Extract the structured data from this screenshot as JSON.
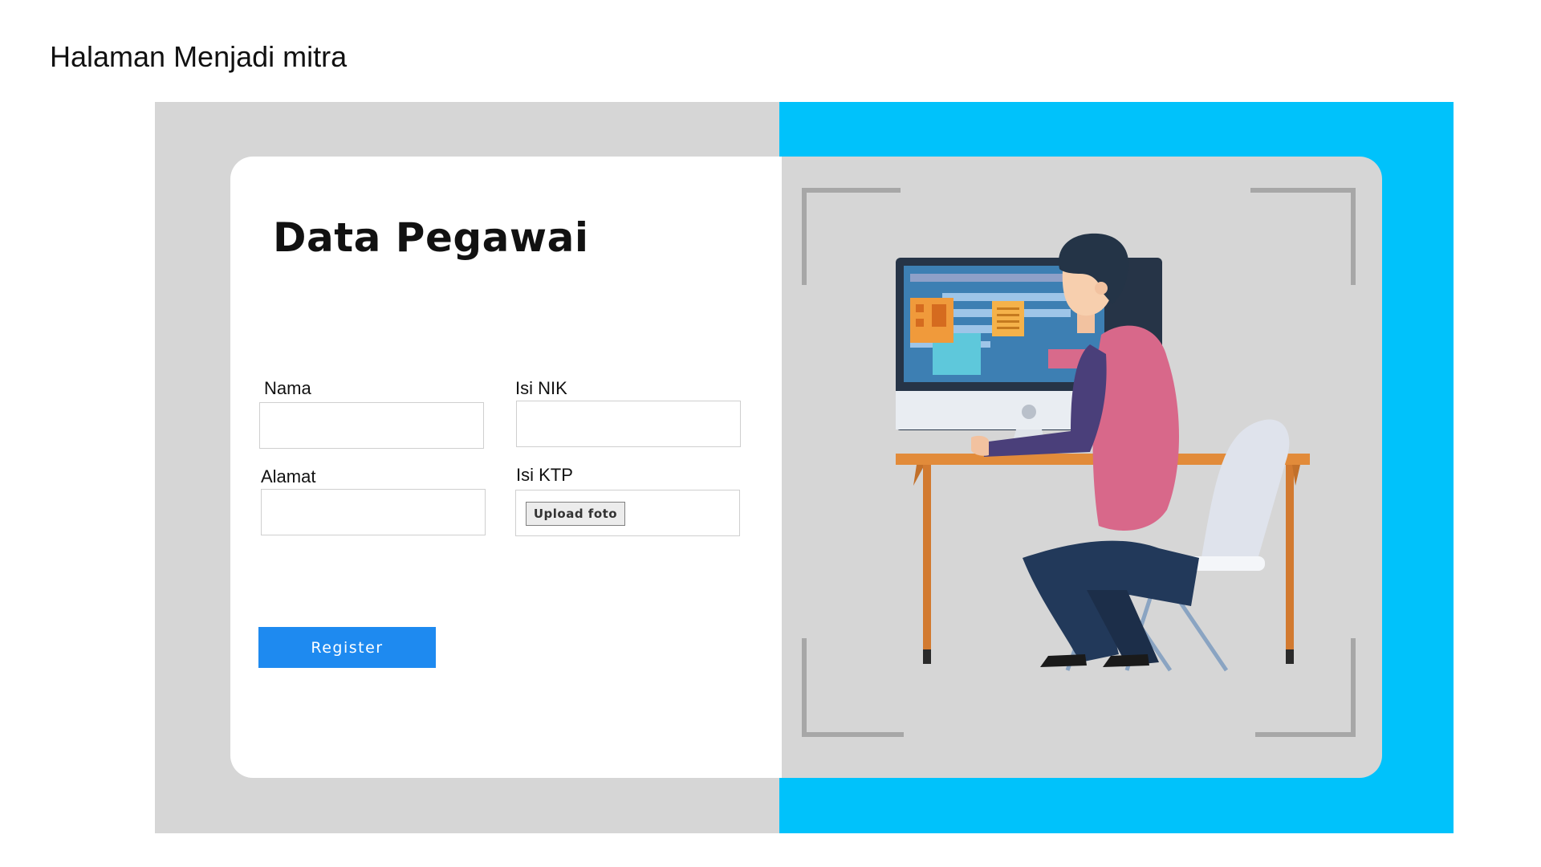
{
  "page": {
    "heading": "Halaman Menjadi mitra"
  },
  "form": {
    "title": "Data Pegawai",
    "fields": {
      "nama": {
        "label": "Nama",
        "value": ""
      },
      "nik": {
        "label": "Isi NIK",
        "value": ""
      },
      "alamat": {
        "label": "Alamat",
        "value": ""
      },
      "ktp": {
        "label": "Isi KTP",
        "button_label": "Upload foto"
      }
    },
    "register_label": "Register"
  },
  "colors": {
    "accent_cyan": "#00c2fb",
    "panel_gray": "#d6d6d6",
    "register_blue": "#1e8af0"
  },
  "illustration": {
    "icon": "person-at-computer-illustration"
  }
}
